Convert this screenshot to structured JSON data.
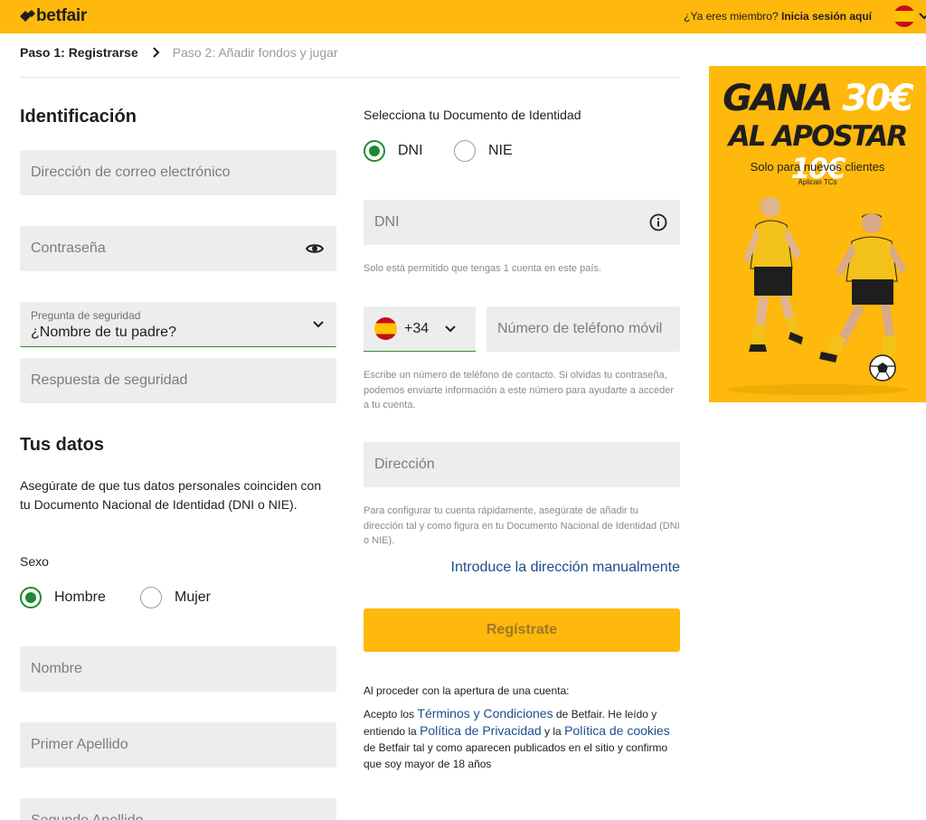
{
  "header": {
    "brand": "betfair",
    "member_prompt": "¿Ya eres miembro?",
    "login_link": "Inicia sesión aquí",
    "brand_color": "#ffb80c"
  },
  "breadcrumb": {
    "step1": "Paso 1: Registrarse",
    "step2": "Paso 2: Añadir fondos y jugar"
  },
  "identification": {
    "title": "Identificación",
    "email_placeholder": "Dirección de correo electrónico",
    "password_placeholder": "Contraseña",
    "security_question_label": "Pregunta de seguridad",
    "security_question_value": "¿Nombre de tu padre?",
    "security_answer_placeholder": "Respuesta de seguridad"
  },
  "personal": {
    "title": "Tus datos",
    "notice": "Asegúrate de que tus datos personales coinciden con tu Documento Nacional de Identidad (DNI o NIE).",
    "sex_label": "Sexo",
    "sex_options": [
      "Hombre",
      "Mujer"
    ],
    "sex_selected": "Hombre",
    "first_name_placeholder": "Nombre",
    "last_name1_placeholder": "Primer Apellido",
    "last_name2_placeholder": "Segundo Apellido"
  },
  "document": {
    "label": "Selecciona tu Documento de Identidad",
    "options": [
      "DNI",
      "NIE"
    ],
    "selected": "DNI",
    "number_placeholder": "DNI",
    "help": "Solo está permitido que tengas 1 cuenta en este país."
  },
  "phone": {
    "prefix": "+34",
    "placeholder": "Número de teléfono móvil",
    "help": "Escribe un número de teléfono de contacto. Si olvidas tu contraseña, podemos enviarte información a este número para ayudarte a acceder a tu cuenta."
  },
  "address": {
    "placeholder": "Dirección",
    "help": "Para configurar tu cuenta rápidamente, asegúrate de añadir tu dirección tal y como figura en tu Documento Nacional de Identidad (DNI o NIE).",
    "manual_link": "Introduce la dirección manualmente"
  },
  "register_button": "Regístrate",
  "legal": {
    "intro": "Al proceder con la apertura de una cuenta:",
    "part1": "Acepto los",
    "terms_link": "Términos y Condiciones",
    "part2": "de Betfair. He leído y entiendo la",
    "privacy_link": "Política de Privacidad",
    "part3": "y la",
    "cookies_link": "Política de cookies",
    "part4": "de Betfair tal y como aparecen publicados en el sitio y confirmo que soy mayor de 18 años"
  },
  "promo": {
    "line1_word": "GANA",
    "line1_amount": "30€",
    "line2_word": "AL APOSTAR",
    "line2_amount": "10€",
    "subtitle": "Solo para nuevos clientes",
    "terms": "Aplican TCs"
  }
}
